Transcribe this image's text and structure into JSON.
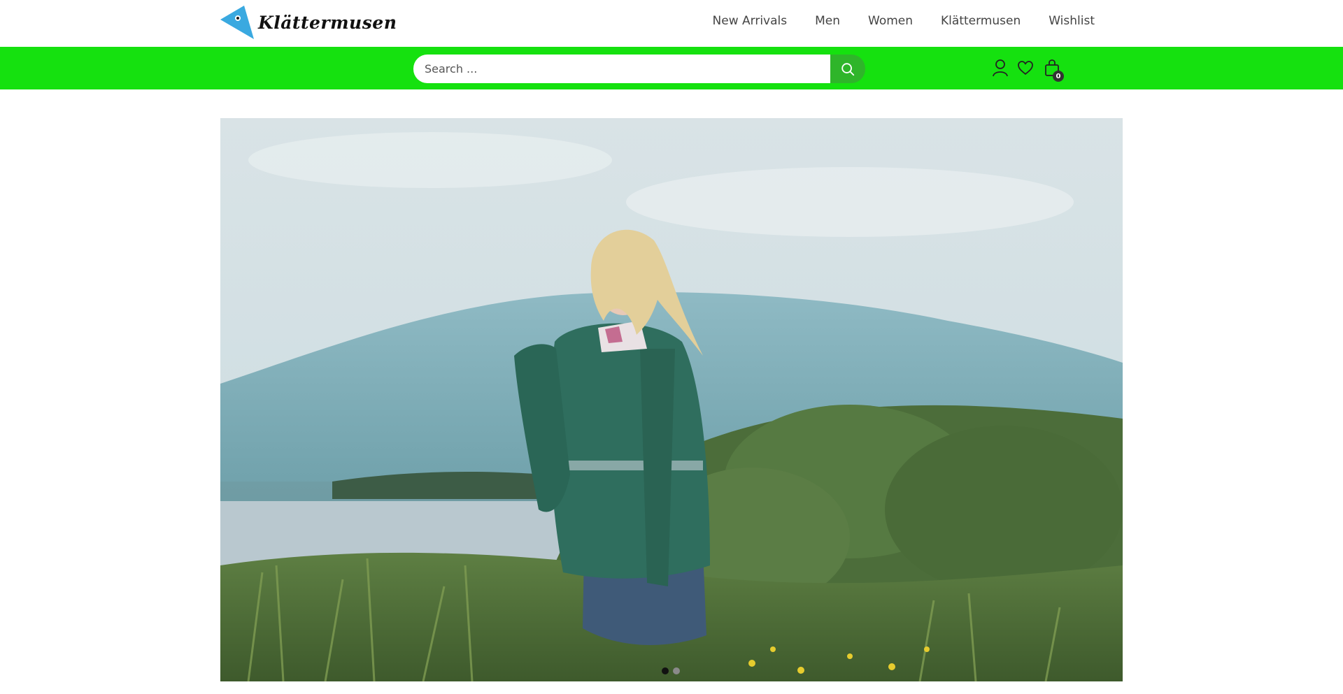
{
  "brand": {
    "name": "Klättermusen",
    "registered_mark": "®",
    "logo_color": "#3aa9e0"
  },
  "nav": {
    "items": [
      {
        "label": "New Arrivals"
      },
      {
        "label": "Men"
      },
      {
        "label": "Women"
      },
      {
        "label": "Klättermusen"
      },
      {
        "label": "Wishlist"
      }
    ]
  },
  "search": {
    "placeholder": "Search ...",
    "value": "",
    "icon": "search-icon"
  },
  "header_icons": {
    "account_icon": "user-icon",
    "wishlist_icon": "heart-icon",
    "cart_icon": "shopping-bag-icon",
    "cart_count": "0"
  },
  "colors": {
    "bar_green": "#15e10f",
    "search_button_green": "#2fb52a"
  },
  "hero": {
    "image_subject": "woman in green sweatshirt standing in tall grass by a lake with a mountain",
    "slides_total": 2,
    "active_slide": 1
  }
}
